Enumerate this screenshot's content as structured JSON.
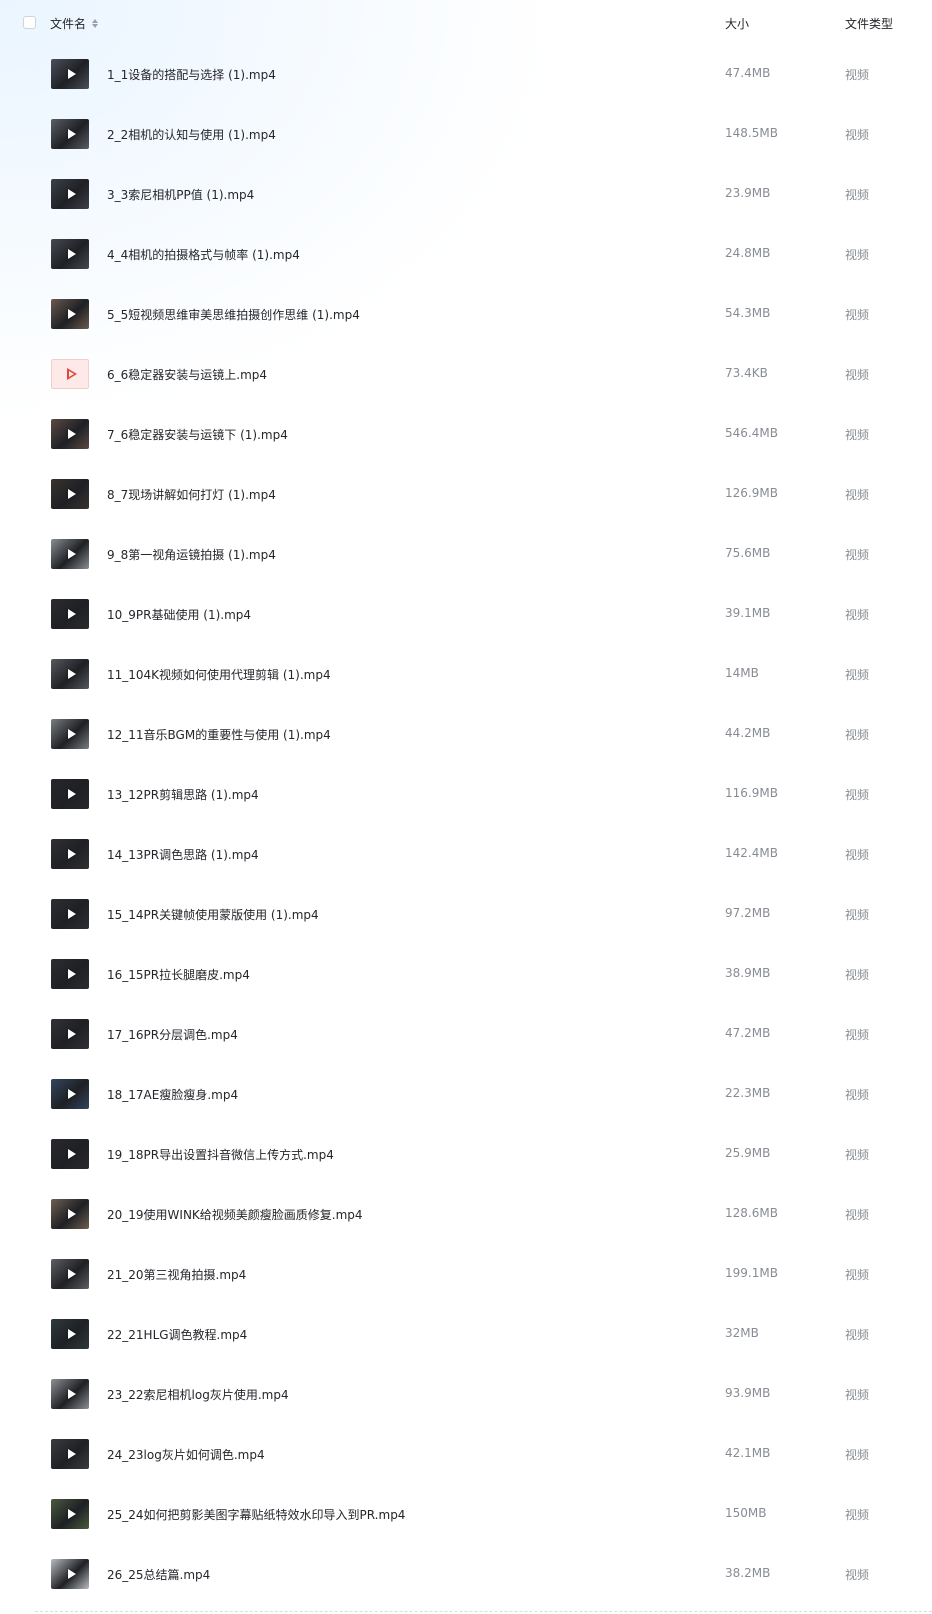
{
  "header": {
    "name": "文件名",
    "size": "大小",
    "type": "文件类型"
  },
  "files": [
    {
      "name": "1_1设备的搭配与选择 (1).mp4",
      "size": "47.4MB",
      "type": "视频",
      "thumb": "#4b4f5c"
    },
    {
      "name": "2_2相机的认知与使用 (1).mp4",
      "size": "148.5MB",
      "type": "视频",
      "thumb": "#5a5e66"
    },
    {
      "name": "3_3索尼相机PP值 (1).mp4",
      "size": "23.9MB",
      "type": "视频",
      "thumb": "#3d4048"
    },
    {
      "name": "4_4相机的拍摄格式与帧率 (1).mp4",
      "size": "24.8MB",
      "type": "视频",
      "thumb": "#45494f"
    },
    {
      "name": "5_5短视频思维审美思维拍摄创作思维 (1).mp4",
      "size": "54.3MB",
      "type": "视频",
      "thumb": "#6b5a4e"
    },
    {
      "name": "6_6稳定器安装与运镜上.mp4",
      "size": "73.4KB",
      "type": "视频",
      "thumb": "placeholder"
    },
    {
      "name": "7_6稳定器安装与运镜下 (1).mp4",
      "size": "546.4MB",
      "type": "视频",
      "thumb": "#5b4a44"
    },
    {
      "name": "8_7现场讲解如何打灯 (1).mp4",
      "size": "126.9MB",
      "type": "视频",
      "thumb": "#3a3330"
    },
    {
      "name": "9_8第一视角运镜拍摄 (1).mp4",
      "size": "75.6MB",
      "type": "视频",
      "thumb": "#8a8e92"
    },
    {
      "name": "10_9PR基础使用 (1).mp4",
      "size": "39.1MB",
      "type": "视频",
      "thumb": "#2a2c30"
    },
    {
      "name": "11_104K视频如何使用代理剪辑 (1).mp4",
      "size": "14MB",
      "type": "视频",
      "thumb": "#55585e"
    },
    {
      "name": "12_11音乐BGM的重要性与使用 (1).mp4",
      "size": "44.2MB",
      "type": "视频",
      "thumb": "#7a7d80"
    },
    {
      "name": "13_12PR剪辑思路 (1).mp4",
      "size": "116.9MB",
      "type": "视频",
      "thumb": "#26282c"
    },
    {
      "name": "14_13PR调色思路 (1).mp4",
      "size": "142.4MB",
      "type": "视频",
      "thumb": "#2f3135"
    },
    {
      "name": "15_14PR关键帧使用蒙版使用 (1).mp4",
      "size": "97.2MB",
      "type": "视频",
      "thumb": "#2c2e33"
    },
    {
      "name": "16_15PR拉长腿磨皮.mp4",
      "size": "38.9MB",
      "type": "视频",
      "thumb": "#2b2d31"
    },
    {
      "name": "17_16PR分层调色.mp4",
      "size": "47.2MB",
      "type": "视频",
      "thumb": "#303236"
    },
    {
      "name": "18_17AE瘦脸瘦身.mp4",
      "size": "22.3MB",
      "type": "视频",
      "thumb": "#34465e"
    },
    {
      "name": "19_18PR导出设置抖音微信上传方式.mp4",
      "size": "25.9MB",
      "type": "视频",
      "thumb": "#2a2a2e"
    },
    {
      "name": "20_19使用WINK给视频美颜瘦脸画质修复.mp4",
      "size": "128.6MB",
      "type": "视频",
      "thumb": "#6e5f52"
    },
    {
      "name": "21_20第三视角拍摄.mp4",
      "size": "199.1MB",
      "type": "视频",
      "thumb": "#5d5f63"
    },
    {
      "name": "22_21HLG调色教程.mp4",
      "size": "32MB",
      "type": "视频",
      "thumb": "#2e3a3c"
    },
    {
      "name": "23_22索尼相机log灰片使用.mp4",
      "size": "93.9MB",
      "type": "视频",
      "thumb": "#8c9094"
    },
    {
      "name": "24_23log灰片如何调色.mp4",
      "size": "42.1MB",
      "type": "视频",
      "thumb": "#3a3c40"
    },
    {
      "name": "25_24如何把剪影美图字幕贴纸特效水印导入到PR.mp4",
      "size": "150MB",
      "type": "视频",
      "thumb": "#4a5a3e"
    },
    {
      "name": "26_25总结篇.mp4",
      "size": "38.2MB",
      "type": "视频",
      "thumb": "#b8bcc0"
    }
  ]
}
